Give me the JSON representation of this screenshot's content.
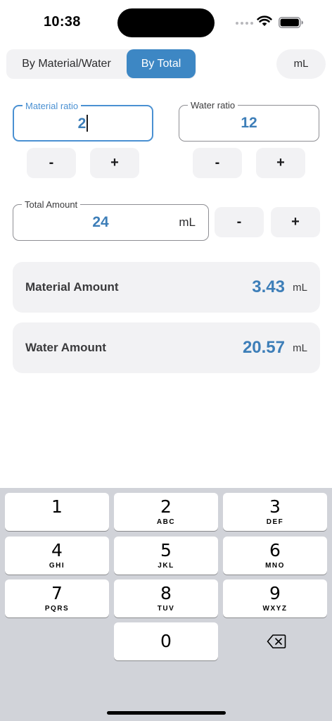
{
  "status_bar": {
    "time": "10:38"
  },
  "mode_segment": {
    "by_material_water": "By Material/Water",
    "by_total": "By Total",
    "selected": "By Total"
  },
  "unit_button": {
    "label": "mL"
  },
  "material_ratio": {
    "label": "Material ratio",
    "value": "2"
  },
  "water_ratio": {
    "label": "Water ratio",
    "value": "12"
  },
  "stepper": {
    "minus": "-",
    "plus": "+"
  },
  "total_amount": {
    "label": "Total Amount",
    "value": "24",
    "unit": "mL"
  },
  "results": [
    {
      "label": "Material Amount",
      "value": "3.43",
      "unit": "mL"
    },
    {
      "label": "Water Amount",
      "value": "20.57",
      "unit": "mL"
    }
  ],
  "keypad": {
    "keys": [
      {
        "num": "1",
        "letters": ""
      },
      {
        "num": "2",
        "letters": "ABC"
      },
      {
        "num": "3",
        "letters": "DEF"
      },
      {
        "num": "4",
        "letters": "GHI"
      },
      {
        "num": "5",
        "letters": "JKL"
      },
      {
        "num": "6",
        "letters": "MNO"
      },
      {
        "num": "7",
        "letters": "PQRS"
      },
      {
        "num": "8",
        "letters": "TUV"
      },
      {
        "num": "9",
        "letters": "WXYZ"
      },
      {
        "num": "0",
        "letters": ""
      }
    ],
    "delete_icon": "delete-backspace-icon"
  },
  "colors": {
    "accent": "#3d87c4",
    "value_text": "#3d7eb8",
    "focus_border": "#4a90d2",
    "keyboard_bg": "#d1d3d9"
  }
}
